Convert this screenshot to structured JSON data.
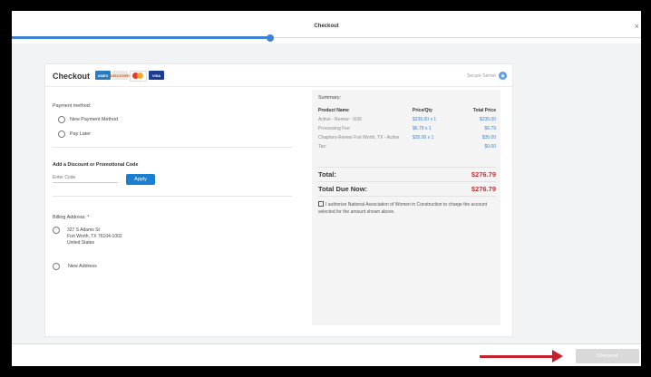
{
  "window": {
    "title": "Checkout",
    "close_label": "×"
  },
  "progress": {
    "fraction": 0.41
  },
  "card": {
    "title": "Checkout",
    "card_brands": [
      {
        "name": "amex",
        "label": "AMEX"
      },
      {
        "name": "discover",
        "label": "DISCOVER"
      },
      {
        "name": "mastercard",
        "label": ""
      },
      {
        "name": "visa",
        "label": "VISA"
      }
    ],
    "secure_label": "Secure Server",
    "secure_icon": "globe-icon"
  },
  "payment": {
    "label": "Payment method:",
    "options": [
      "New Payment Method",
      "Pay Later"
    ]
  },
  "discount": {
    "label": "Add a Discount or Promotional Code",
    "placeholder": "Enter Code",
    "apply_label": "Apply"
  },
  "billing": {
    "label": "Billing Address:",
    "required_mark": "*",
    "address_lines": [
      "327 S Adams St",
      "Fort Worth, TX 76104-1002",
      "United States"
    ],
    "new_address_label": "New Address"
  },
  "summary": {
    "title": "Summary:",
    "headers": [
      "Product Name",
      "Price/Qty",
      "Total Price"
    ],
    "rows": [
      {
        "name": "Active - Renew - 9/30",
        "qty": "$235.00 x 1",
        "total": "$235.00"
      },
      {
        "name": "Processing Fee",
        "qty": "$6.79 x 1",
        "total": "$6.79"
      },
      {
        "name": "Chapters-Renew Fort Worth, TX - Active",
        "qty": "$35.00 x 1",
        "total": "$35.00"
      }
    ],
    "tax_label": "Tax:",
    "tax_value": "$0.00",
    "total_label": "Total:",
    "total_value": "$276.79",
    "due_label": "Total Due Now:",
    "due_value": "$276.79",
    "authorize_text": "I authorize National Association of Women in Construction to charge the account selected for the amount shown above."
  },
  "footer": {
    "checkout_label": "Checkout"
  },
  "colors": {
    "accent": "#3d82d6",
    "apply": "#1a7fd0",
    "total": "#b5363a",
    "arrow": "#c8202b"
  }
}
